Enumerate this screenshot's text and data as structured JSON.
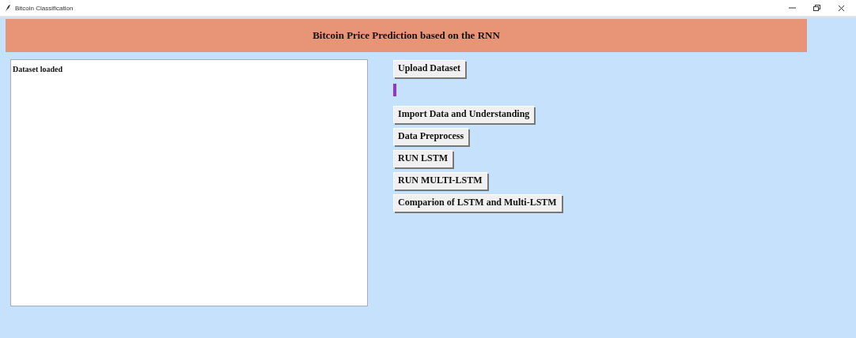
{
  "window": {
    "title": "Bitcoin Classification"
  },
  "header": {
    "title": "Bitcoin Price Prediction based on the RNN"
  },
  "output": {
    "text": "Dataset loaded"
  },
  "upload_button": "Upload Dataset",
  "buttons": [
    {
      "label": "Import Data and Understanding"
    },
    {
      "label": "Data Preprocess"
    },
    {
      "label": "RUN LSTM"
    },
    {
      "label": "RUN MULTI-LSTM"
    },
    {
      "label": "Comparion of LSTM and Multi-LSTM"
    }
  ]
}
